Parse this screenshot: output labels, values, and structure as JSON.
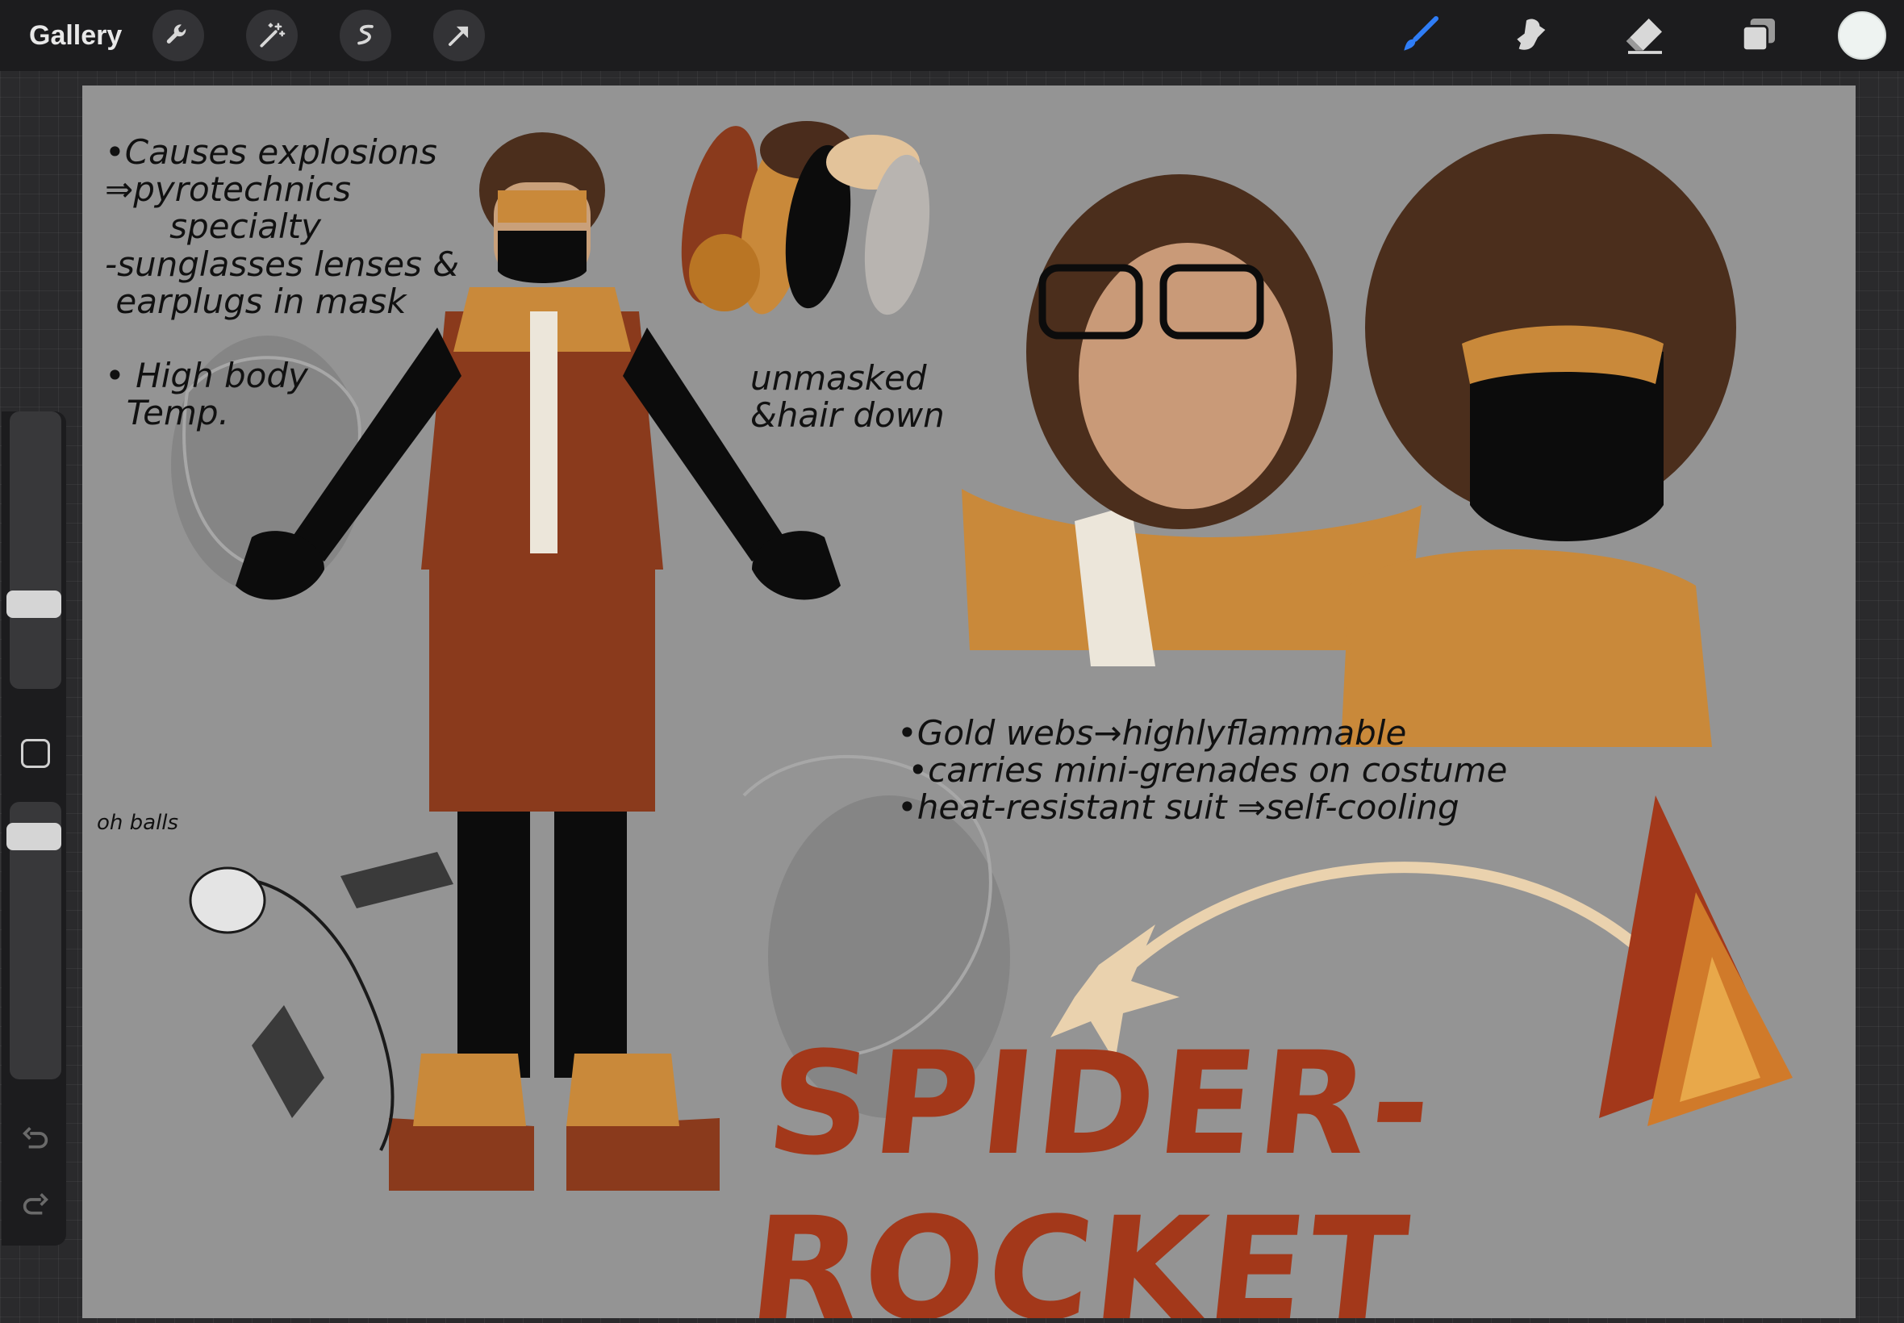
{
  "toolbar": {
    "gallery_label": "Gallery",
    "left_tools": [
      "wrench-icon",
      "magic-wand-icon",
      "selection-icon",
      "transform-arrow-icon"
    ],
    "right_tools": [
      "brush-icon",
      "smudge-icon",
      "eraser-icon",
      "layers-icon"
    ],
    "current_color": "#eef3f1",
    "active_tool_color": "#2f7df6"
  },
  "sidebar": {
    "tools": [
      "brush-size-slider",
      "modify-button",
      "opacity-slider",
      "undo-icon",
      "redo-icon"
    ]
  },
  "canvas": {
    "background": "#949494",
    "palette_colors": [
      "#8a3a1c",
      "#c9893a",
      "#4a2c1c",
      "#0c0c0c",
      "#e3c39a",
      "#b8b4b0",
      "#b97524"
    ],
    "notes": {
      "abilities": "•Causes explosions\n⇒pyrotechnics\n      specialty\n-sunglasses lenses &\n earplugs in mask\n\n• High body\n  Temp.",
      "unmasked": "unmasked\n&hair down",
      "oh_balls": "oh balls",
      "suit_notes": "•Gold webs→highlyflammable\n •carries mini-grenades on costume\n•heat-resistant suit ⇒self-cooling"
    },
    "title_art": "SPIDER-ROCKET"
  }
}
